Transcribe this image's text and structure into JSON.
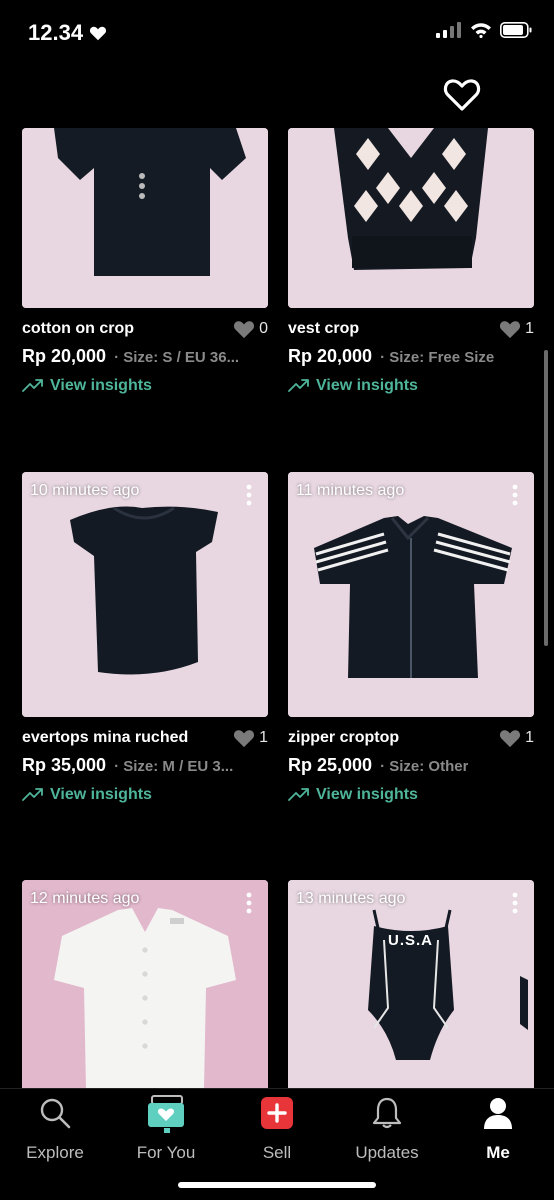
{
  "status": {
    "time": "12.34"
  },
  "listings": [
    {
      "time": "",
      "title": "cotton on crop",
      "likes": "0",
      "price": "Rp 20,000",
      "size": "· Size: S / EU 36...",
      "insights": "View insights"
    },
    {
      "time": "",
      "title": "vest crop",
      "likes": "1",
      "price": "Rp 20,000",
      "size": "· Size: Free Size",
      "insights": "View insights"
    },
    {
      "time": "10 minutes ago",
      "title": "evertops mina ruched",
      "likes": "1",
      "price": "Rp 35,000",
      "size": "· Size: M / EU 3...",
      "insights": "View insights"
    },
    {
      "time": "11 minutes ago",
      "title": "zipper croptop",
      "likes": "1",
      "price": "Rp 25,000",
      "size": "· Size: Other",
      "insights": "View insights"
    },
    {
      "time": "12 minutes ago"
    },
    {
      "time": "13 minutes ago"
    }
  ],
  "nav": {
    "explore": "Explore",
    "foryou": "For You",
    "sell": "Sell",
    "updates": "Updates",
    "me": "Me"
  },
  "colors": {
    "accent": "#4fb59a",
    "sell": "#e8353a",
    "photo_bg": "#e9d6e0"
  }
}
